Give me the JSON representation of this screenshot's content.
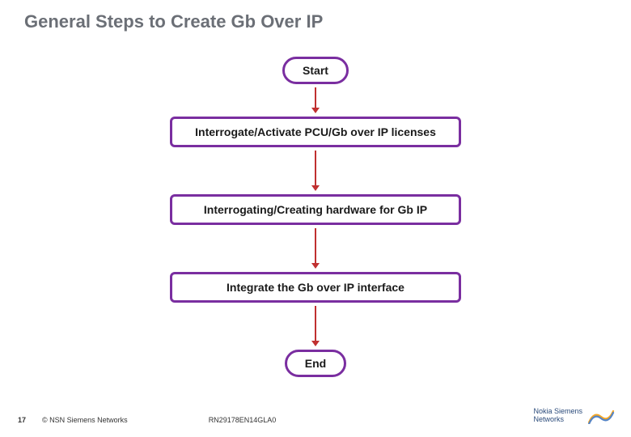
{
  "title": "General Steps to Create Gb Over IP",
  "flow": {
    "start": "Start",
    "step1": "Interrogate/Activate PCU/Gb over IP licenses",
    "step2": "Interrogating/Creating hardware for Gb IP",
    "step3": "Integrate the Gb over IP interface",
    "end": "End"
  },
  "footer": {
    "page_no": "17",
    "copyright": "© NSN Siemens Networks",
    "doc_id": "RN29178EN14GLA0",
    "brand_line1": "Nokia Siemens",
    "brand_line2": "Networks"
  },
  "colors": {
    "node_border": "#7a2ea0",
    "arrow": "#c03030",
    "title": "#6b6f76",
    "brand_text": "#2a4a7a",
    "logo_accent1": "#f5a623",
    "logo_accent2": "#5584c4"
  }
}
